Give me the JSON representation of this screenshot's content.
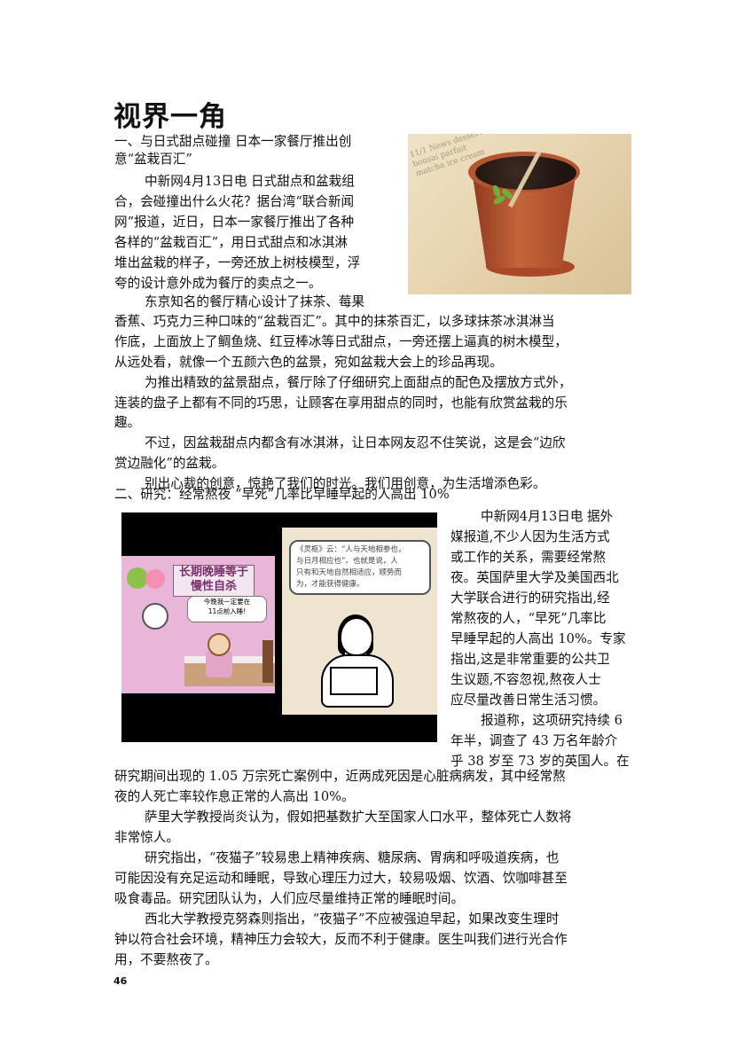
{
  "section_title": "视界一角",
  "article1": {
    "heading_lines": [
      "一、与日式甜点碰撞 日本一家餐厅推出创",
      "意“盆栽百汇”"
    ],
    "lines": [
      "中新网4月13日电 日式甜点和盆栽组",
      "合，会碰撞出什么火花？据台湾“联合新闻",
      "网”报道，近日，日本一家餐厅推出了各种",
      "各样的“盆栽百汇”，用日式甜点和冰淇淋",
      "堆出盆栽的样子，一旁还放上树枝模型，浮",
      "夸的设计意外成为餐厅的卖点之一。",
      "东京知名的餐厅精心设计了抹茶、莓果",
      "香蕉、巧克力三种口味的“盆栽百汇”。其中的抹茶百汇，以多球抹茶冰淇淋当",
      "作底，上面放上了鲷鱼烧、红豆棒冰等日式甜点，一旁还摆上逼真的树木模型，",
      "从远处看，就像一个五颜六色的盆景，宛如盆栽大会上的珍品再现。",
      "为推出精致的盆景甜点，餐厅除了仔细研究上面甜点的配色及摆放方式外，",
      "连装的盘子上都有不同的巧思，让顾客在享用甜点的同时，也能有欣赏盆栽的乐",
      "趣。",
      "不过，因盆栽甜点内都含有冰淇淋，让日本网友忍不住笑说，这是会“边欣",
      "赏边融化”的盆栽。",
      "别出心裁的创意，惊艳了我们的时光。我们用创意，为生活增添色彩。"
    ]
  },
  "article2": {
    "heading": "二、研究：经常熬夜 “早死”几率比早睡早起的人高出 10%",
    "lines": [
      "中新网4月13日电 据外",
      "媒报道,不少人因为生活方式",
      "或工作的关系，需要经常熬",
      "夜。英国萨里大学及美国西北",
      "大学联合进行的研究指出,经",
      "常熬夜的人，“早死”几率比",
      "早睡早起的人高出 10%。专家",
      "指出,这是非常重要的公共卫",
      "生议题,不容忽视,熬夜人士",
      "应尽量改善日常生活习惯。",
      "报道称，这项研究持续 6",
      "年半，调查了 43 万名年龄介",
      "乎 38 岁至 73 岁的英国人。在",
      "研究期间出现的 1.05 万宗死亡案例中，近两成死因是心脏病病发，其中经常熬",
      "夜的人死亡率较作息正常的人高出 10%。",
      "萨里大学教授尚炎认为，假如把基数扩大至国家人口水平，整体死亡人数将",
      "非常惊人。",
      "研究指出，“夜猫子”较易患上精神疾病、糖尿病、胃病和呼吸道疾病，也",
      "可能因没有充足运动和睡眠，导致心理压力过大，较易吸烟、饮酒、饮咖啡甚至",
      "吸食毒品。研究团队认为，人们应尽量维持正常的睡眠时间。",
      "西北大学教授克努森则指出，“夜猫子”不应被强迫早起，如果改变生理时",
      "钟以符合社会环境，精神压力会较大，反而不利于健康。医生叫我们进行光合作",
      "用，不要熬夜了。"
    ]
  },
  "comic": {
    "sign_lines": [
      "长期晚睡等于",
      "慢性自杀"
    ],
    "bubble1_lines": [
      "今晚我一定要在",
      "11点前入睡!"
    ],
    "bubble2_lines": [
      "《灵枢》云：“人与天地相参也，",
      "与日月相应也”。也就是说，人",
      "只有和天地自然相适应，顺势而",
      "为，才能获得健康。"
    ]
  },
  "photo1_news_text": "11/1 News dessert\nbonsai parfait\nmatcha ice cream",
  "page_number": "46"
}
